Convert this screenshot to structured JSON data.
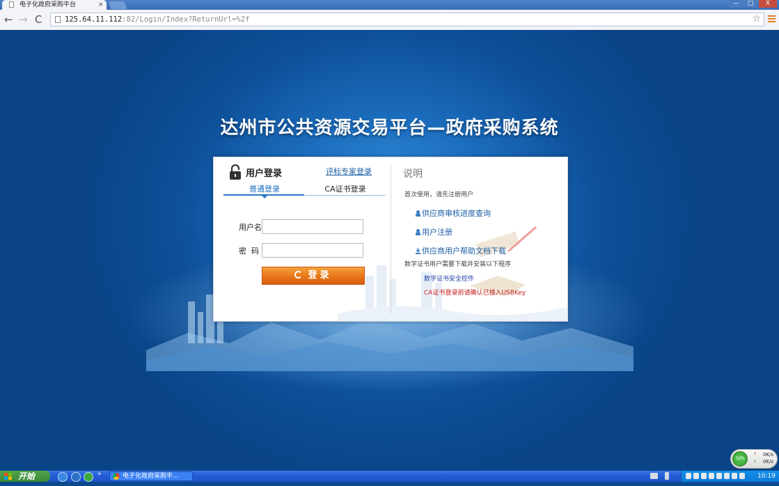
{
  "browser": {
    "tab_title": "电子化政府采购平台",
    "tab_close": "×",
    "url_host": "125.64.11.112",
    "url_rest": ":82/Login/Index?ReturnUrl=%2f",
    "window_controls": {
      "minimize": "—",
      "maximize": "□",
      "close": "X"
    },
    "nav": {
      "back": "←",
      "forward": "→",
      "reload": "C"
    }
  },
  "page": {
    "title": "达州市公共资源交易平台—政府采购系统",
    "login": {
      "heading": "用户登录",
      "expert_login": "评标专家登录",
      "tabs": {
        "normal": "普通登录",
        "ca": "CA证书登录"
      },
      "username_label": "用户名",
      "password_label": "密  码",
      "username_value": "",
      "password_value": "",
      "submit": "登录"
    },
    "explain": {
      "heading": "说明",
      "first_use": "首次使用，请先注册用户",
      "links": [
        "供应商审核进度查询",
        "用户注册",
        "供应商用户帮助文档下载"
      ],
      "cert_note": "数字证书用户需要下载并安装以下程序",
      "cert_control": "数字证书安全控件",
      "ca_warning": "CA证书登录前请确认已插入USBKey"
    }
  },
  "taskbar": {
    "start": "开始",
    "more": "»",
    "task_item": "电子化政府采购平...",
    "clock": "10:19"
  },
  "net_widget": {
    "percent": "52%",
    "up_speed": "0K/s",
    "down_speed": "0K/s"
  }
}
